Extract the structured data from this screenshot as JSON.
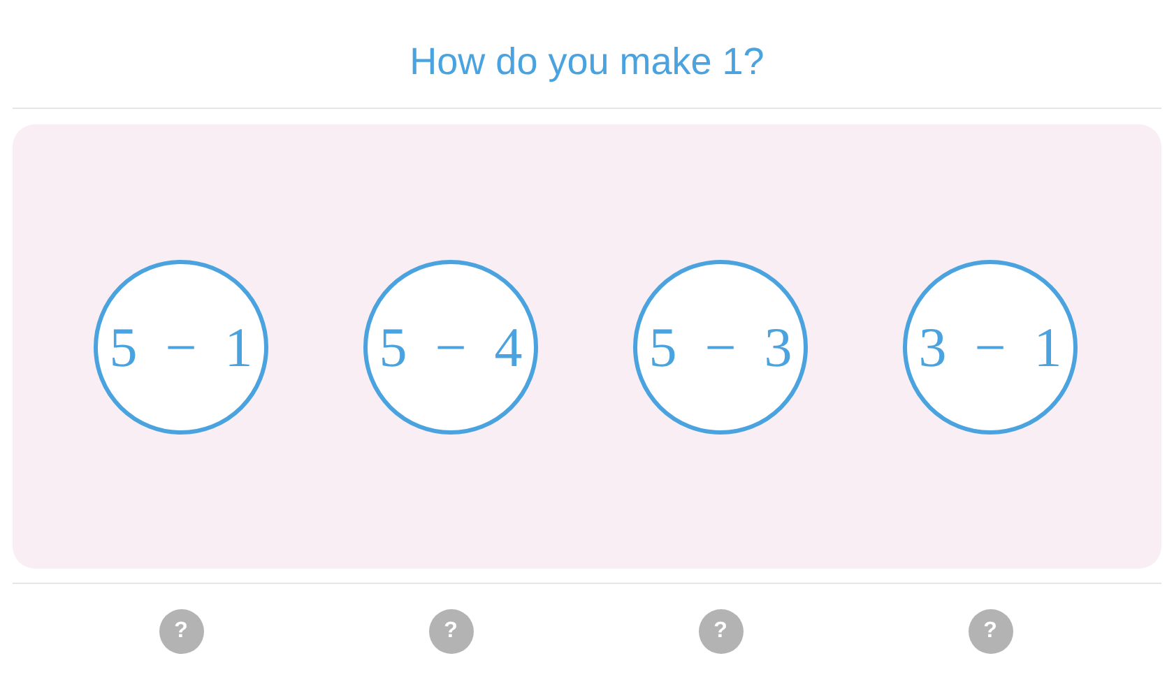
{
  "question": "How do you make 1?",
  "options": [
    {
      "text": "5 − 1",
      "selected": false
    },
    {
      "text": "5 − 4",
      "selected": false
    },
    {
      "text": "5 − 3",
      "selected": false
    },
    {
      "text": "3 − 1",
      "selected": false
    }
  ],
  "hints": [
    "?",
    "?",
    "?",
    "?"
  ]
}
